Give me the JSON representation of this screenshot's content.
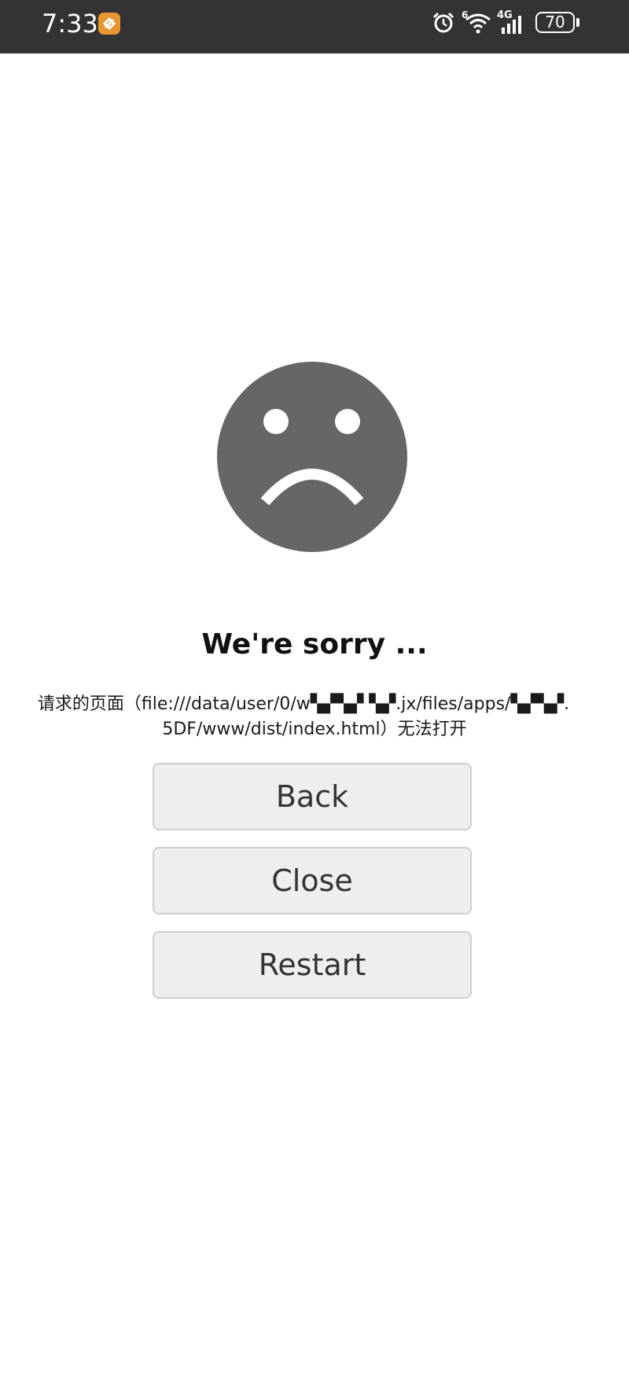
{
  "status_bar": {
    "time": "7:33",
    "network": "4G",
    "sim": "6",
    "battery": "70",
    "icons": [
      "app-notification-icon",
      "alarm-icon",
      "wifi-icon",
      "cellular-signal-icon",
      "battery-icon"
    ],
    "colors": {
      "background": "#333333",
      "badge": "#e8962f"
    }
  },
  "error_page": {
    "icon": "sad-face-icon",
    "title": "We're sorry ...",
    "message_line1": "请求的页面（file:///data/user/0/w▚▞▚▞ ▚▞.jx/files/apps/▚▞▚▞.",
    "message_line2": "5DF/www/dist/index.html）无法打开",
    "buttons": {
      "back": "Back",
      "close": "Close",
      "restart": "Restart"
    },
    "colors": {
      "face": "#666666",
      "button_bg": "#eeeeee",
      "button_border": "#cfcfcf"
    }
  }
}
